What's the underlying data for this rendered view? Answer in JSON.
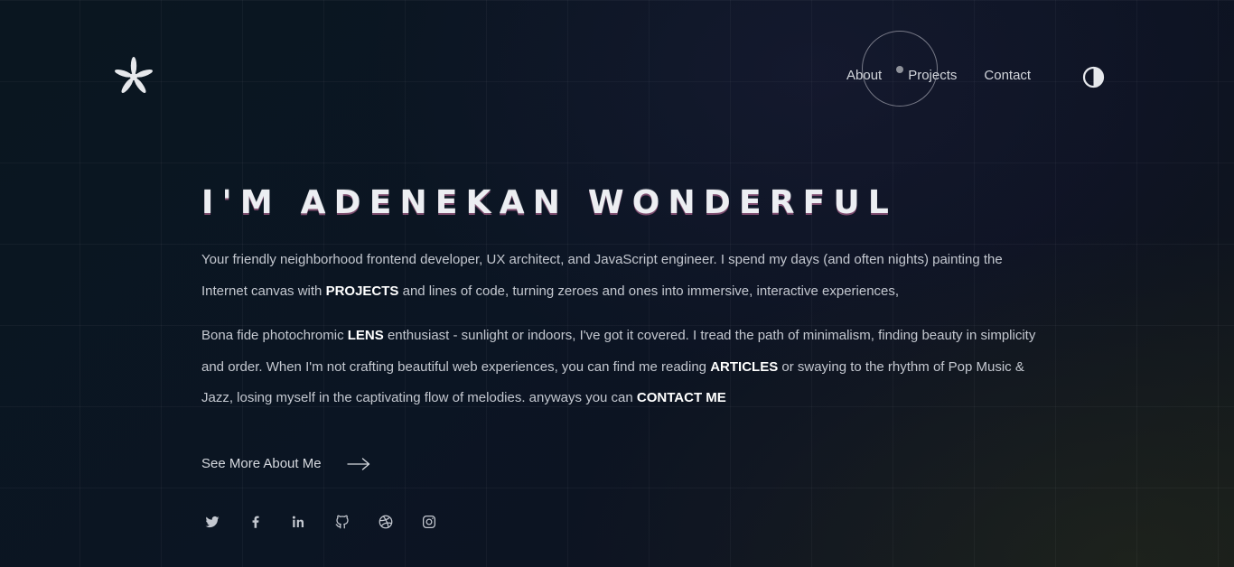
{
  "header": {
    "logo_icon": "asterisk-logo-icon",
    "nav": [
      {
        "label": "About"
      },
      {
        "label": "Projects"
      },
      {
        "label": "Contact"
      }
    ],
    "theme_toggle_icon": "contrast-icon"
  },
  "hero": {
    "title": "I'M ADENEKAN WONDERFUL",
    "para1": {
      "t1": "Your friendly neighborhood frontend developer, UX architect, and JavaScript engineer. I spend my days (and often nights) painting the Internet canvas with ",
      "b1": "PROJECTS",
      "t2": " and lines of code, turning zeroes and ones into immersive, interactive experiences,"
    },
    "para2": {
      "t1": "Bona fide photochromic ",
      "b1": "LENS",
      "t2": " enthusiast - sunlight or indoors, I've got it covered. I tread the path of minimalism, finding beauty in simplicity and order. When I'm not crafting beautiful web experiences, you can find me reading ",
      "b2": "ARTICLES",
      "t3": " or swaying to the rhythm of Pop Music & Jazz, losing myself in the captivating flow of melodies. anyways you can ",
      "b3": "CONTACT ME"
    },
    "see_more": "See More About Me",
    "see_more_icon": "arrow-right-icon"
  },
  "socials": [
    {
      "icon": "twitter-icon"
    },
    {
      "icon": "facebook-icon"
    },
    {
      "icon": "linkedin-icon"
    },
    {
      "icon": "github-icon"
    },
    {
      "icon": "dribbble-icon"
    },
    {
      "icon": "instagram-icon"
    }
  ],
  "colors": {
    "background": "#0b1523",
    "text": "#c4c8d0",
    "heading": "#eceef2",
    "title_accent": "#d878aa"
  }
}
